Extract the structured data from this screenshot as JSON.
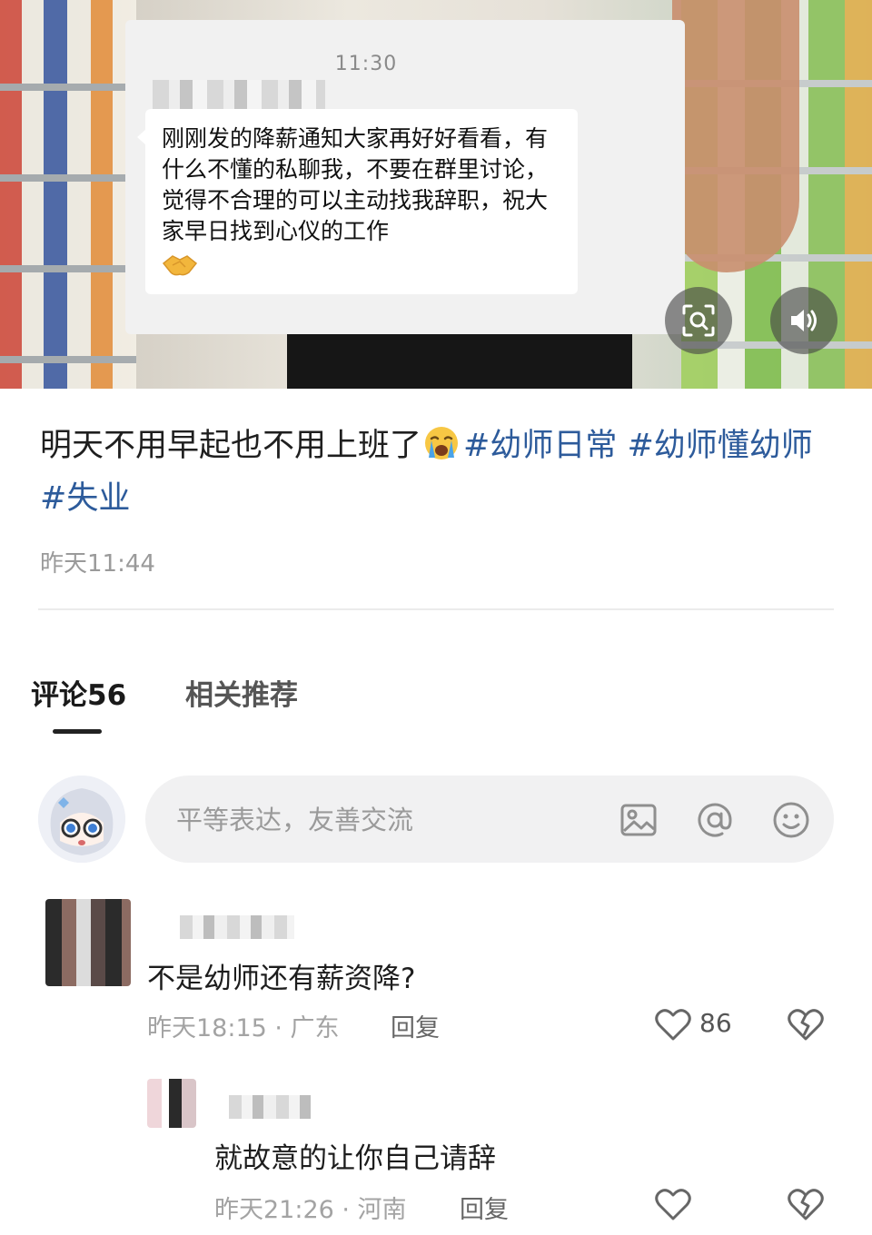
{
  "media": {
    "chat_time": "11:30",
    "chat_message": "刚刚发的降薪通知大家再好好看看，有什么不懂的私聊我，不要在群里讨论，觉得不合理的可以主动找我辞职，祝大家早日找到心仪的工作",
    "chat_emoji": "handshake-emoji"
  },
  "post": {
    "caption_text": "明天不用早起也不用上班了",
    "caption_emoji": "crying-face-emoji",
    "hashtags": [
      "#幼师日常",
      "#幼师懂幼师",
      "#失业"
    ],
    "time": "昨天11:44"
  },
  "tabs": {
    "comments_label": "评论56",
    "related_label": "相关推荐"
  },
  "comment_input": {
    "placeholder": "平等表达，友善交流"
  },
  "comments": [
    {
      "text": "不是幼师还有薪资降?",
      "meta": "昨天18:15 · 广东",
      "reply_label": "回复",
      "likes": "86"
    },
    {
      "text": "就故意的让你自己请辞",
      "meta": "昨天21:26 · 河南",
      "reply_label": "回复",
      "likes": ""
    }
  ],
  "colors": {
    "hashtag": "#2d5b9b",
    "meta_gray": "#a3a3a3",
    "input_bg": "#f1f1f2"
  }
}
